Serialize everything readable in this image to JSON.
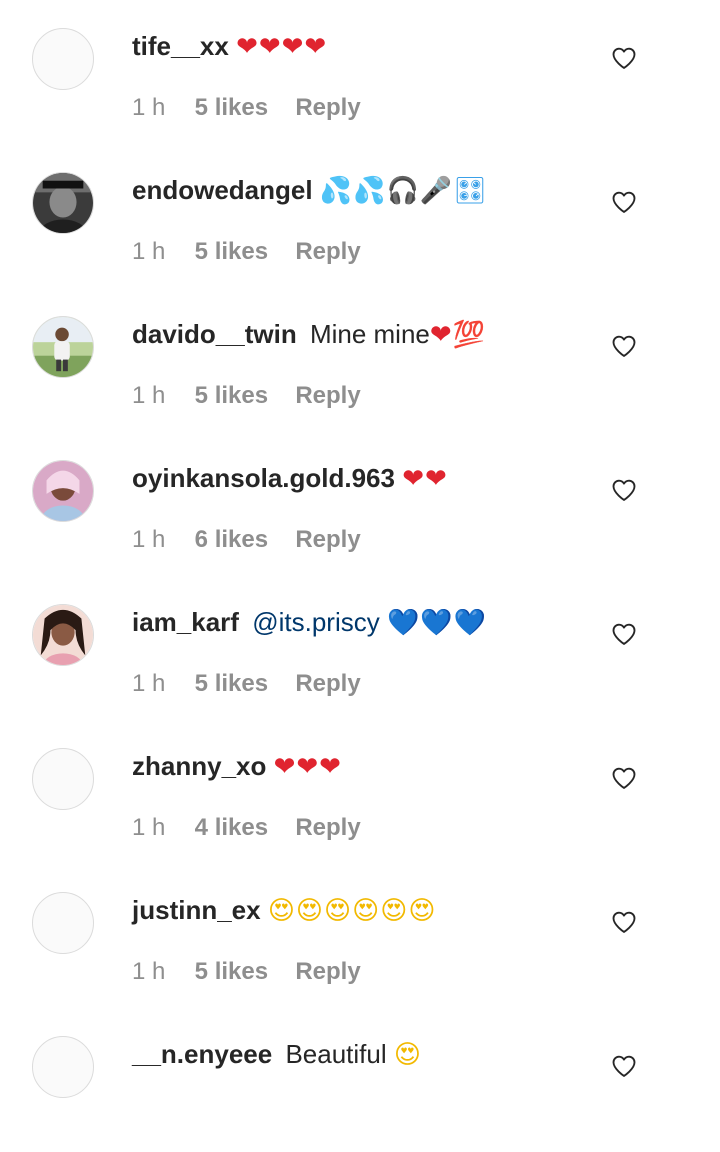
{
  "comments": [
    {
      "username": "tife__xx",
      "text": "",
      "emoji": "❤❤❤❤",
      "emoji_color": "#e0242f",
      "time": "1 h",
      "likes": "5 likes",
      "reply": "Reply"
    },
    {
      "username": "endowedangel",
      "text": "",
      "emoji": "💦💦🎧🎤🎛",
      "emoji_color": "#3aa0e8",
      "time": "1 h",
      "likes": "5 likes",
      "reply": "Reply"
    },
    {
      "username": "davido__twin",
      "text": "Mine mine",
      "emoji": "❤💯",
      "emoji_color": "#e0242f",
      "time": "1 h",
      "likes": "5 likes",
      "reply": "Reply"
    },
    {
      "username": "oyinkansola.gold.963",
      "text": "",
      "emoji": "❤❤",
      "emoji_color": "#e0242f",
      "time": "1 h",
      "likes": "6 likes",
      "reply": "Reply"
    },
    {
      "username": "iam_karf",
      "mention": "@its.priscy",
      "text": "",
      "emoji": "💙💙💙",
      "emoji_color": "#1d8ae6",
      "time": "1 h",
      "likes": "5 likes",
      "reply": "Reply"
    },
    {
      "username": "zhanny_xo",
      "text": "",
      "emoji": "❤❤❤",
      "emoji_color": "#e0242f",
      "time": "1 h",
      "likes": "4 likes",
      "reply": "Reply"
    },
    {
      "username": "justinn_ex",
      "text": "",
      "emoji": "😍😍😍😍😍😍",
      "emoji_color": "#f2b900",
      "time": "1 h",
      "likes": "5 likes",
      "reply": "Reply"
    },
    {
      "username": "__n.enyeee",
      "text": "Beautiful",
      "emoji": "😍",
      "emoji_color": "#f2b900",
      "time": "",
      "likes": "",
      "reply": ""
    }
  ],
  "colors": {
    "username": "#262626",
    "meta": "#8e8e8e",
    "mention": "#00376b",
    "avatar_border": "#dbdbdb"
  },
  "icons": {
    "like": "heart-outline-icon"
  }
}
